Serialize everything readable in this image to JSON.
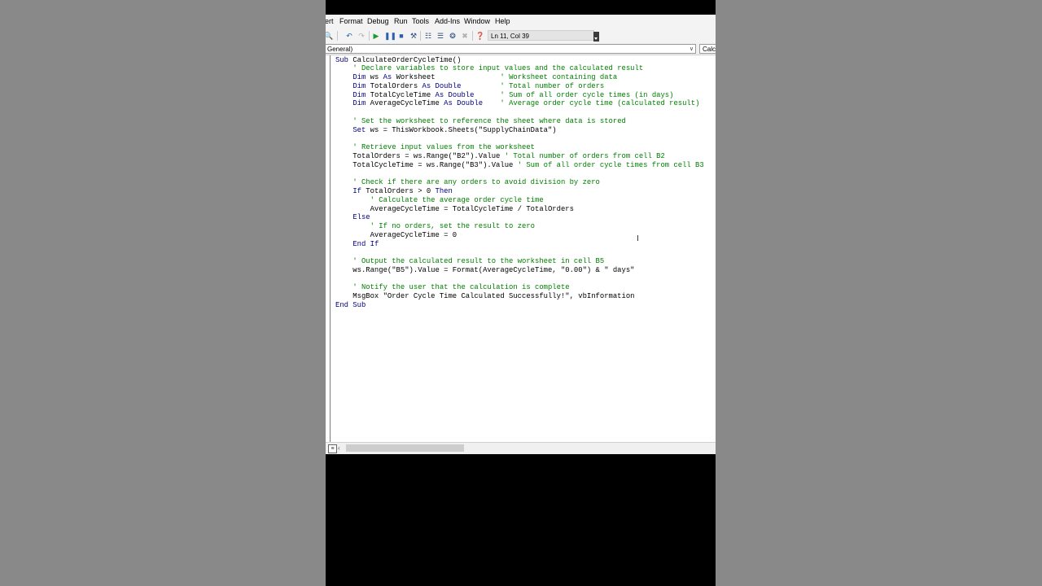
{
  "menu": [
    "ert",
    "Format",
    "Debug",
    "Run",
    "Tools",
    "Add-Ins",
    "Window",
    "Help"
  ],
  "toolbar": {
    "status": "Ln 11, Col 39"
  },
  "combos": {
    "object": "General)",
    "procedure": "Calc"
  },
  "code": [
    [
      [
        "kw",
        "Sub "
      ],
      [
        "",
        "CalculateOrderCycleTime()"
      ]
    ],
    [
      [
        "",
        "    "
      ],
      [
        "cm",
        "' Declare variables to store input values and the calculated result"
      ]
    ],
    [
      [
        "",
        "    "
      ],
      [
        "kw",
        "Dim "
      ],
      [
        "",
        "ws "
      ],
      [
        "kw",
        "As "
      ],
      [
        "",
        "Worksheet               "
      ],
      [
        "cm",
        "' Worksheet containing data"
      ]
    ],
    [
      [
        "",
        "    "
      ],
      [
        "kw",
        "Dim "
      ],
      [
        "",
        "TotalOrders "
      ],
      [
        "kw",
        "As Double"
      ],
      [
        "",
        "         "
      ],
      [
        "cm",
        "' Total number of orders"
      ]
    ],
    [
      [
        "",
        "    "
      ],
      [
        "kw",
        "Dim "
      ],
      [
        "",
        "TotalCycleTime "
      ],
      [
        "kw",
        "As Double"
      ],
      [
        "",
        "      "
      ],
      [
        "cm",
        "' Sum of all order cycle times (in days)"
      ]
    ],
    [
      [
        "",
        "    "
      ],
      [
        "kw",
        "Dim "
      ],
      [
        "",
        "AverageCycleTime "
      ],
      [
        "kw",
        "As Double"
      ],
      [
        "",
        "    "
      ],
      [
        "cm",
        "' Average order cycle time (calculated result)"
      ]
    ],
    [
      [
        "",
        ""
      ]
    ],
    [
      [
        "",
        "    "
      ],
      [
        "cm",
        "' Set the worksheet to reference the sheet where data is stored"
      ]
    ],
    [
      [
        "",
        "    "
      ],
      [
        "kw",
        "Set "
      ],
      [
        "",
        "ws = ThisWorkbook.Sheets(\"SupplyChainData\")"
      ]
    ],
    [
      [
        "",
        ""
      ]
    ],
    [
      [
        "",
        "    "
      ],
      [
        "cm",
        "' Retrieve input values from the worksheet"
      ]
    ],
    [
      [
        "",
        "    TotalOrders = ws.Range(\"B2\").Value "
      ],
      [
        "cm",
        "' Total number of orders from cell B2"
      ]
    ],
    [
      [
        "",
        "    TotalCycleTime = ws.Range(\"B3\").Value "
      ],
      [
        "cm",
        "' Sum of all order cycle times from cell B3"
      ]
    ],
    [
      [
        "",
        ""
      ]
    ],
    [
      [
        "",
        "    "
      ],
      [
        "cm",
        "' Check if there are any orders to avoid division by zero"
      ]
    ],
    [
      [
        "",
        "    "
      ],
      [
        "kw",
        "If "
      ],
      [
        "",
        "TotalOrders > 0 "
      ],
      [
        "kw",
        "Then"
      ]
    ],
    [
      [
        "",
        "        "
      ],
      [
        "cm",
        "' Calculate the average order cycle time"
      ]
    ],
    [
      [
        "",
        "        AverageCycleTime = TotalCycleTime / TotalOrders"
      ]
    ],
    [
      [
        "",
        "    "
      ],
      [
        "kw",
        "Else"
      ]
    ],
    [
      [
        "",
        "        "
      ],
      [
        "cm",
        "' If no orders, set the result to zero"
      ]
    ],
    [
      [
        "",
        "        AverageCycleTime = 0"
      ]
    ],
    [
      [
        "",
        "    "
      ],
      [
        "kw",
        "End If"
      ]
    ],
    [
      [
        "",
        ""
      ]
    ],
    [
      [
        "",
        "    "
      ],
      [
        "cm",
        "' Output the calculated result to the worksheet in cell B5"
      ]
    ],
    [
      [
        "",
        "    ws.Range(\"B5\").Value = Format(AverageCycleTime, \"0.00\") & \" days\""
      ]
    ],
    [
      [
        "",
        ""
      ]
    ],
    [
      [
        "",
        "    "
      ],
      [
        "cm",
        "' Notify the user that the calculation is complete"
      ]
    ],
    [
      [
        "",
        "    MsgBox \"Order Cycle Time Calculated Successfully!\", vbInformation"
      ]
    ],
    [
      [
        "kw",
        "End Sub"
      ]
    ]
  ]
}
